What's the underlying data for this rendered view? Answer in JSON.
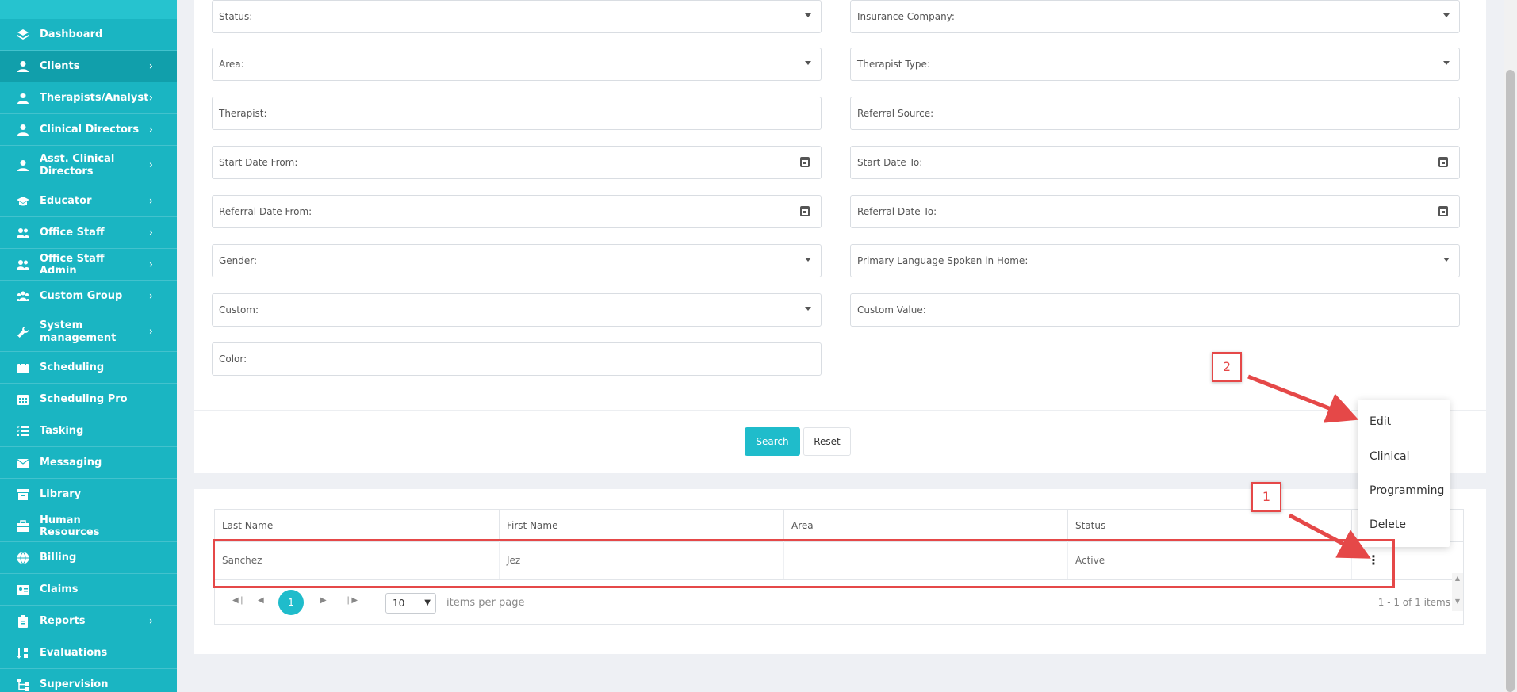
{
  "sidebar": {
    "items": [
      {
        "label": "Dashboard",
        "icon": "layers-icon",
        "chevron": false
      },
      {
        "label": "Clients",
        "icon": "user-icon",
        "chevron": true,
        "active": true
      },
      {
        "label": "Therapists/Analyst",
        "icon": "user-icon",
        "chevron": true
      },
      {
        "label": "Clinical Directors",
        "icon": "user-icon",
        "chevron": true
      },
      {
        "label": "Asst. Clinical Directors",
        "icon": "user-icon",
        "chevron": true
      },
      {
        "label": "Educator",
        "icon": "graduation-cap-icon",
        "chevron": true
      },
      {
        "label": "Office Staff",
        "icon": "users-icon",
        "chevron": true
      },
      {
        "label": "Office Staff Admin",
        "icon": "users-icon",
        "chevron": true
      },
      {
        "label": "Custom Group",
        "icon": "group-icon",
        "chevron": true
      },
      {
        "label": "System management",
        "icon": "wrench-icon",
        "chevron": true
      },
      {
        "label": "Scheduling",
        "icon": "calendar-icon",
        "chevron": false
      },
      {
        "label": "Scheduling Pro",
        "icon": "calendar-grid-icon",
        "chevron": false
      },
      {
        "label": "Tasking",
        "icon": "task-list-icon",
        "chevron": false
      },
      {
        "label": "Messaging",
        "icon": "envelope-icon",
        "chevron": false
      },
      {
        "label": "Library",
        "icon": "archive-icon",
        "chevron": false
      },
      {
        "label": "Human Resources",
        "icon": "briefcase-icon",
        "chevron": false
      },
      {
        "label": "Billing",
        "icon": "globe-icon",
        "chevron": false
      },
      {
        "label": "Claims",
        "icon": "id-card-icon",
        "chevron": false
      },
      {
        "label": "Reports",
        "icon": "clipboard-icon",
        "chevron": true
      },
      {
        "label": "Evaluations",
        "icon": "sort-icon",
        "chevron": false
      },
      {
        "label": "Supervision",
        "icon": "sitemap-icon",
        "chevron": false
      }
    ]
  },
  "filters": {
    "status": "Status:",
    "insurance_company": "Insurance Company:",
    "area": "Area:",
    "therapist_type": "Therapist Type:",
    "therapist": "Therapist:",
    "referral_source": "Referral Source:",
    "start_date_from": "Start Date From:",
    "start_date_to": "Start Date To:",
    "referral_date_from": "Referral Date From:",
    "referral_date_to": "Referral Date To:",
    "gender": "Gender:",
    "primary_language": "Primary Language Spoken in Home:",
    "custom": "Custom:",
    "custom_value": "Custom Value:",
    "color": "Color:"
  },
  "actions": {
    "search": "Search",
    "reset": "Reset"
  },
  "table": {
    "columns": [
      "Last Name",
      "First Name",
      "Area",
      "Status"
    ],
    "rows": [
      {
        "last_name": "Sanchez",
        "first_name": "Jez",
        "area": "",
        "status": "Active"
      }
    ]
  },
  "pager": {
    "current_page": "1",
    "page_size": "10",
    "items_per_page": "items per page",
    "info": "1 - 1 of 1 items"
  },
  "menu": {
    "items": [
      "Edit",
      "Clinical",
      "Programming",
      "Delete"
    ]
  },
  "annotations": {
    "marker_1": "1",
    "marker_2": "2",
    "color": "#e54848"
  }
}
